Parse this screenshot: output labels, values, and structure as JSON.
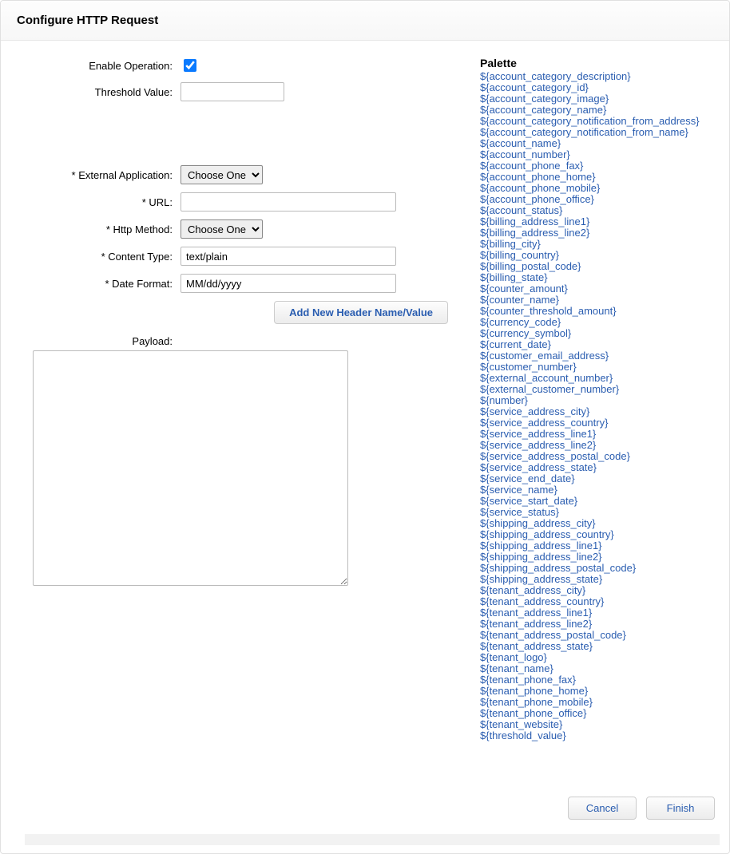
{
  "header": {
    "title": "Configure HTTP Request"
  },
  "form": {
    "enable_operation": {
      "label": "Enable Operation:",
      "checked": true
    },
    "threshold_value": {
      "label": "Threshold Value:",
      "value": ""
    },
    "external_application": {
      "label": "* External Application:",
      "selected": "Choose One"
    },
    "url": {
      "label": "* URL:",
      "value": ""
    },
    "http_method": {
      "label": "* Http Method:",
      "selected": "Choose One"
    },
    "content_type": {
      "label": "* Content Type:",
      "value": "text/plain"
    },
    "date_format": {
      "label": "* Date Format:",
      "value": "MM/dd/yyyy"
    },
    "add_header_button": "Add New Header Name/Value",
    "payload": {
      "label": "Payload:",
      "value": ""
    }
  },
  "palette": {
    "title": "Palette",
    "items": [
      "${account_category_description}",
      "${account_category_id}",
      "${account_category_image}",
      "${account_category_name}",
      "${account_category_notification_from_address}",
      "${account_category_notification_from_name}",
      "${account_name}",
      "${account_number}",
      "${account_phone_fax}",
      "${account_phone_home}",
      "${account_phone_mobile}",
      "${account_phone_office}",
      "${account_status}",
      "${billing_address_line1}",
      "${billing_address_line2}",
      "${billing_city}",
      "${billing_country}",
      "${billing_postal_code}",
      "${billing_state}",
      "${counter_amount}",
      "${counter_name}",
      "${counter_threshold_amount}",
      "${currency_code}",
      "${currency_symbol}",
      "${current_date}",
      "${customer_email_address}",
      "${customer_number}",
      "${external_account_number}",
      "${external_customer_number}",
      "${number}",
      "${service_address_city}",
      "${service_address_country}",
      "${service_address_line1}",
      "${service_address_line2}",
      "${service_address_postal_code}",
      "${service_address_state}",
      "${service_end_date}",
      "${service_name}",
      "${service_start_date}",
      "${service_status}",
      "${shipping_address_city}",
      "${shipping_address_country}",
      "${shipping_address_line1}",
      "${shipping_address_line2}",
      "${shipping_address_postal_code}",
      "${shipping_address_state}",
      "${tenant_address_city}",
      "${tenant_address_country}",
      "${tenant_address_line1}",
      "${tenant_address_line2}",
      "${tenant_address_postal_code}",
      "${tenant_address_state}",
      "${tenant_logo}",
      "${tenant_name}",
      "${tenant_phone_fax}",
      "${tenant_phone_home}",
      "${tenant_phone_mobile}",
      "${tenant_phone_office}",
      "${tenant_website}",
      "${threshold_value}"
    ]
  },
  "footer": {
    "cancel": "Cancel",
    "finish": "Finish"
  }
}
